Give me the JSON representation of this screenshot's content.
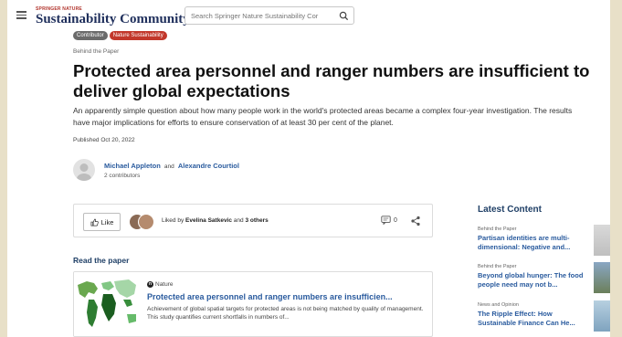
{
  "header": {
    "brand_top": "SPRINGER NATURE",
    "brand_main": "Sustainability Community",
    "search_placeholder": "Search Springer Nature Sustainability Cor"
  },
  "tags": [
    "Contributor",
    "Nature Sustainability"
  ],
  "article": {
    "kicker": "Behind the Paper",
    "title": "Protected area personnel and ranger numbers are insufficient to deliver global expectations",
    "summary": "An apparently simple question about how many people work in the world's protected areas became a complex four-year investigation. The results have major implications for efforts to ensure conservation of at least 30 per cent of the planet.",
    "published": "Published Oct 20, 2022"
  },
  "authors": {
    "first": "Michael Appleton",
    "sep": "and",
    "second": "Alexandre Courtiol",
    "count": "2 contributors"
  },
  "actions": {
    "like_label": "Like",
    "liked_prefix": "Liked by",
    "liked_name": "Evelina Satkevic",
    "liked_and": "and",
    "liked_others": "3 others",
    "comment_count": "0"
  },
  "read_paper": {
    "label": "Read the paper",
    "source": "Nature",
    "title": "Protected area personnel and ranger numbers are insufficien...",
    "description": "Achievement of global spatial targets for protected areas is not being matched by quality of management. This study quantifies current shortfalls in numbers of..."
  },
  "sidebar": {
    "title": "Latest Content",
    "items": [
      {
        "kicker": "Behind the Paper",
        "title": "Partisan identities are multi-dimensional: Negative and..."
      },
      {
        "kicker": "Behind the Paper",
        "title": "Beyond global hunger: The food people need may not b..."
      },
      {
        "kicker": "News and Opinion",
        "title": "The Ripple Effect: How Sustainable Finance Can He..."
      }
    ]
  },
  "colors": {
    "brand_navy": "#1f2f5c",
    "accent_red": "#c2372b",
    "link_blue": "#2a5b9e",
    "background_frame": "#e8e0c8"
  },
  "icons": [
    "menu-icon",
    "search-icon",
    "thumbs-up-icon",
    "comment-icon",
    "share-icon",
    "nature-logo-icon"
  ]
}
